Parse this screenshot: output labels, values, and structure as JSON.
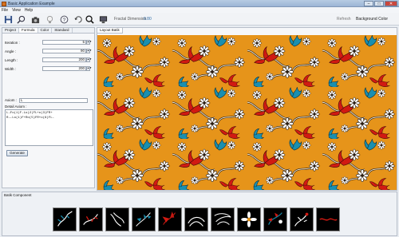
{
  "window": {
    "title": "Basic Application Example"
  },
  "menu": [
    "File",
    "View",
    "Help"
  ],
  "toolbar": {
    "fractal_label": "Fractal Dimension :",
    "fractal_value": "0.00",
    "refresh_label": "Refresh",
    "background_color_label": "Background Color",
    "icons": [
      "save-icon",
      "zoom-icon",
      "camera-icon",
      "lightbulb-icon",
      "help-icon",
      "rotate-icon",
      "pan-icon",
      "magnify-icon",
      "monitor-icon"
    ]
  },
  "left_tabs": [
    "Project",
    "Formula",
    "Color",
    "Standard"
  ],
  "form": {
    "iteration": {
      "label": "Iteration :",
      "value": "5"
    },
    "angle": {
      "label": "Angle :",
      "value": "90"
    },
    "length": {
      "label": "Length :",
      "value": "200"
    },
    "width": {
      "label": "Width :",
      "value": "200"
    },
    "axiom": {
      "label": "Axiom :",
      "value": "L"
    },
    "detail_label": "Detail Axiom :",
    "rules": "L→Fo(1)F-Lo(2)FL+o(3)FR+\nR→-Lo(1)F+Ro(5)FR+o(6)FL-"
  },
  "generate_label": "Generate",
  "right_tab": "Layout Batik",
  "bottom": {
    "label": "Batik Component"
  },
  "colors": {
    "orange": "#e6941a",
    "red": "#d11a12",
    "teal": "#1a8fb0",
    "white": "#ffffff",
    "dark": "#2b1d10"
  }
}
